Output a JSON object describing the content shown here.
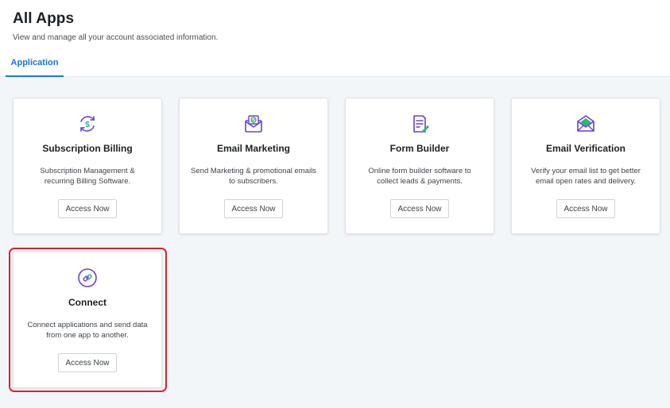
{
  "header": {
    "title": "All Apps",
    "subtitle": "View and manage all your account associated information.",
    "tabs": [
      {
        "label": "Application",
        "active": true
      }
    ]
  },
  "colors": {
    "accent": "#1a73e8",
    "icon_purple": "#6b3fd4",
    "icon_green": "#2bb673",
    "highlight": "#e0202b"
  },
  "apps": [
    {
      "name": "Subscription Billing",
      "icon": "subscription-billing-icon",
      "description": "Subscription Management & recurring Billing Software.",
      "button": "Access Now"
    },
    {
      "name": "Email Marketing",
      "icon": "email-marketing-icon",
      "description": "Send Marketing & promotional emails to subscribers.",
      "button": "Access Now"
    },
    {
      "name": "Form Builder",
      "icon": "form-builder-icon",
      "description": "Online form builder software to collect leads & payments.",
      "button": "Access Now"
    },
    {
      "name": "Email Verification",
      "icon": "email-verification-icon",
      "description": "Verify your email list to get better email open rates and delivery.",
      "button": "Access Now"
    },
    {
      "name": "Connect",
      "icon": "connect-icon",
      "description": "Connect applications and send data from one app to another.",
      "button": "Access Now",
      "highlighted": true
    }
  ]
}
